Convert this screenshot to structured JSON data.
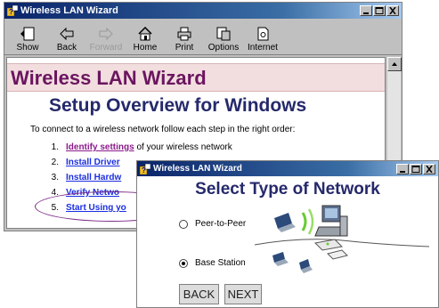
{
  "main_window": {
    "title": "Wireless LAN Wizard",
    "toolbar": [
      {
        "label": "Show",
        "icon": "show-icon",
        "enabled": true
      },
      {
        "label": "Back",
        "icon": "back-arrow-icon",
        "enabled": true
      },
      {
        "label": "Forward",
        "icon": "forward-arrow-icon",
        "enabled": false
      },
      {
        "label": "Home",
        "icon": "home-icon",
        "enabled": true
      },
      {
        "label": "Print",
        "icon": "printer-icon",
        "enabled": true
      },
      {
        "label": "Options",
        "icon": "options-icon",
        "enabled": true
      },
      {
        "label": "Internet",
        "icon": "internet-icon",
        "enabled": true
      }
    ],
    "banner_title": "Wireless LAN Wizard",
    "heading": "Setup Overview for Windows",
    "intro": "To connect to a wireless network follow each step in the right order:",
    "steps": [
      {
        "num": "1.",
        "link": "Identify settings",
        "rest": " of your wireless network"
      },
      {
        "num": "2.",
        "link": "Install Driver",
        "rest": ""
      },
      {
        "num": "3.",
        "link": "Install Hardw",
        "rest": ""
      },
      {
        "num": "4.",
        "link": "Verify Netwo",
        "rest": ""
      },
      {
        "num": "5.",
        "link": "Start Using yo",
        "rest": ""
      }
    ]
  },
  "dialog": {
    "title": "Wireless LAN Wizard",
    "heading": "Select Type of Network",
    "options": [
      {
        "label": "Peer-to-Peer",
        "selected": false
      },
      {
        "label": "Base Station",
        "selected": true
      }
    ],
    "back_label": "BACK",
    "next_label": "NEXT"
  },
  "colors": {
    "titlebar": "#0a246a",
    "banner_bg": "#f2dede",
    "banner_text": "#6b1560",
    "heading": "#25296b",
    "link": "#1a2ee0",
    "visited_link": "#8b1a8b"
  }
}
